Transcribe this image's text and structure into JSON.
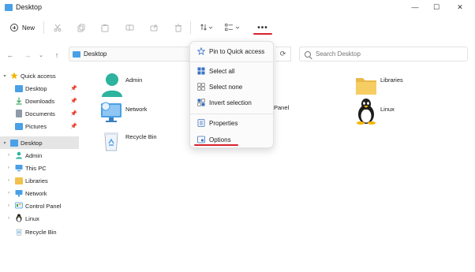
{
  "window": {
    "title": "Desktop",
    "controls": {
      "minimize": "—",
      "maximize": "☐",
      "close": "✕"
    }
  },
  "toolbar": {
    "new_label": "New",
    "more_label": "•••",
    "icons": [
      "cut-icon",
      "copy-icon",
      "paste-icon",
      "rename-icon",
      "share-icon",
      "delete-icon",
      "sort-icon",
      "view-icon"
    ]
  },
  "address_bar": {
    "path": "Desktop",
    "search_placeholder": "Search Desktop"
  },
  "sidebar": {
    "items": [
      {
        "label": "Quick access",
        "icon": "star-icon",
        "color": "#f5b400",
        "level": 0,
        "expanded": true
      },
      {
        "label": "Desktop",
        "icon": "desktop-folder-icon",
        "color": "#4aa0e6",
        "level": 1,
        "pinned": true
      },
      {
        "label": "Downloads",
        "icon": "downloads-folder-icon",
        "color": "#3aa55d",
        "level": 1,
        "pinned": true
      },
      {
        "label": "Documents",
        "icon": "documents-folder-icon",
        "color": "#8e9aa8",
        "level": 1,
        "pinned": true
      },
      {
        "label": "Pictures",
        "icon": "pictures-folder-icon",
        "color": "#4aa0e6",
        "level": 1,
        "pinned": true
      },
      {
        "label": "Desktop",
        "icon": "desktop-folder-icon",
        "color": "#4aa0e6",
        "level": 0,
        "expanded": true,
        "selected": true
      },
      {
        "label": "Admin",
        "icon": "user-icon",
        "color": "#2db39e",
        "level": 1
      },
      {
        "label": "This PC",
        "icon": "pc-icon",
        "color": "#4aa0e6",
        "level": 1
      },
      {
        "label": "Libraries",
        "icon": "libraries-icon",
        "color": "#f2c14e",
        "level": 1
      },
      {
        "label": "Network",
        "icon": "network-icon",
        "color": "#4aa0e6",
        "level": 1
      },
      {
        "label": "Control Panel",
        "icon": "control-panel-icon",
        "color": "#4aa0e6",
        "level": 1
      },
      {
        "label": "Linux",
        "icon": "linux-icon",
        "color": "#222222",
        "level": 1
      },
      {
        "label": "Recycle Bin",
        "icon": "recycle-bin-icon",
        "color": "#4aa0e6",
        "level": 1
      }
    ]
  },
  "content": {
    "items": [
      {
        "label": "Admin",
        "icon": "user-icon"
      },
      {
        "label": "Libraries",
        "icon": "libraries-icon"
      },
      {
        "label": "Network",
        "icon": "network-icon"
      },
      {
        "label": "Panel",
        "icon": "control-panel-icon"
      },
      {
        "label": "Linux",
        "icon": "linux-icon"
      },
      {
        "label": "Recycle Bin",
        "icon": "recycle-bin-icon"
      }
    ]
  },
  "context_menu": {
    "items": [
      {
        "label": "Pin to Quick access",
        "icon": "pin-star-icon"
      },
      {
        "label": "Select all",
        "icon": "select-all-icon"
      },
      {
        "label": "Select none",
        "icon": "select-none-icon"
      },
      {
        "label": "Invert selection",
        "icon": "invert-selection-icon"
      },
      {
        "label": "Properties",
        "icon": "properties-icon"
      },
      {
        "label": "Options",
        "icon": "options-icon",
        "highlighted": true
      }
    ]
  },
  "colors": {
    "accent": "#4aa0e6",
    "annotation_red": "#d8232a",
    "selection": "#e5e5e5"
  }
}
